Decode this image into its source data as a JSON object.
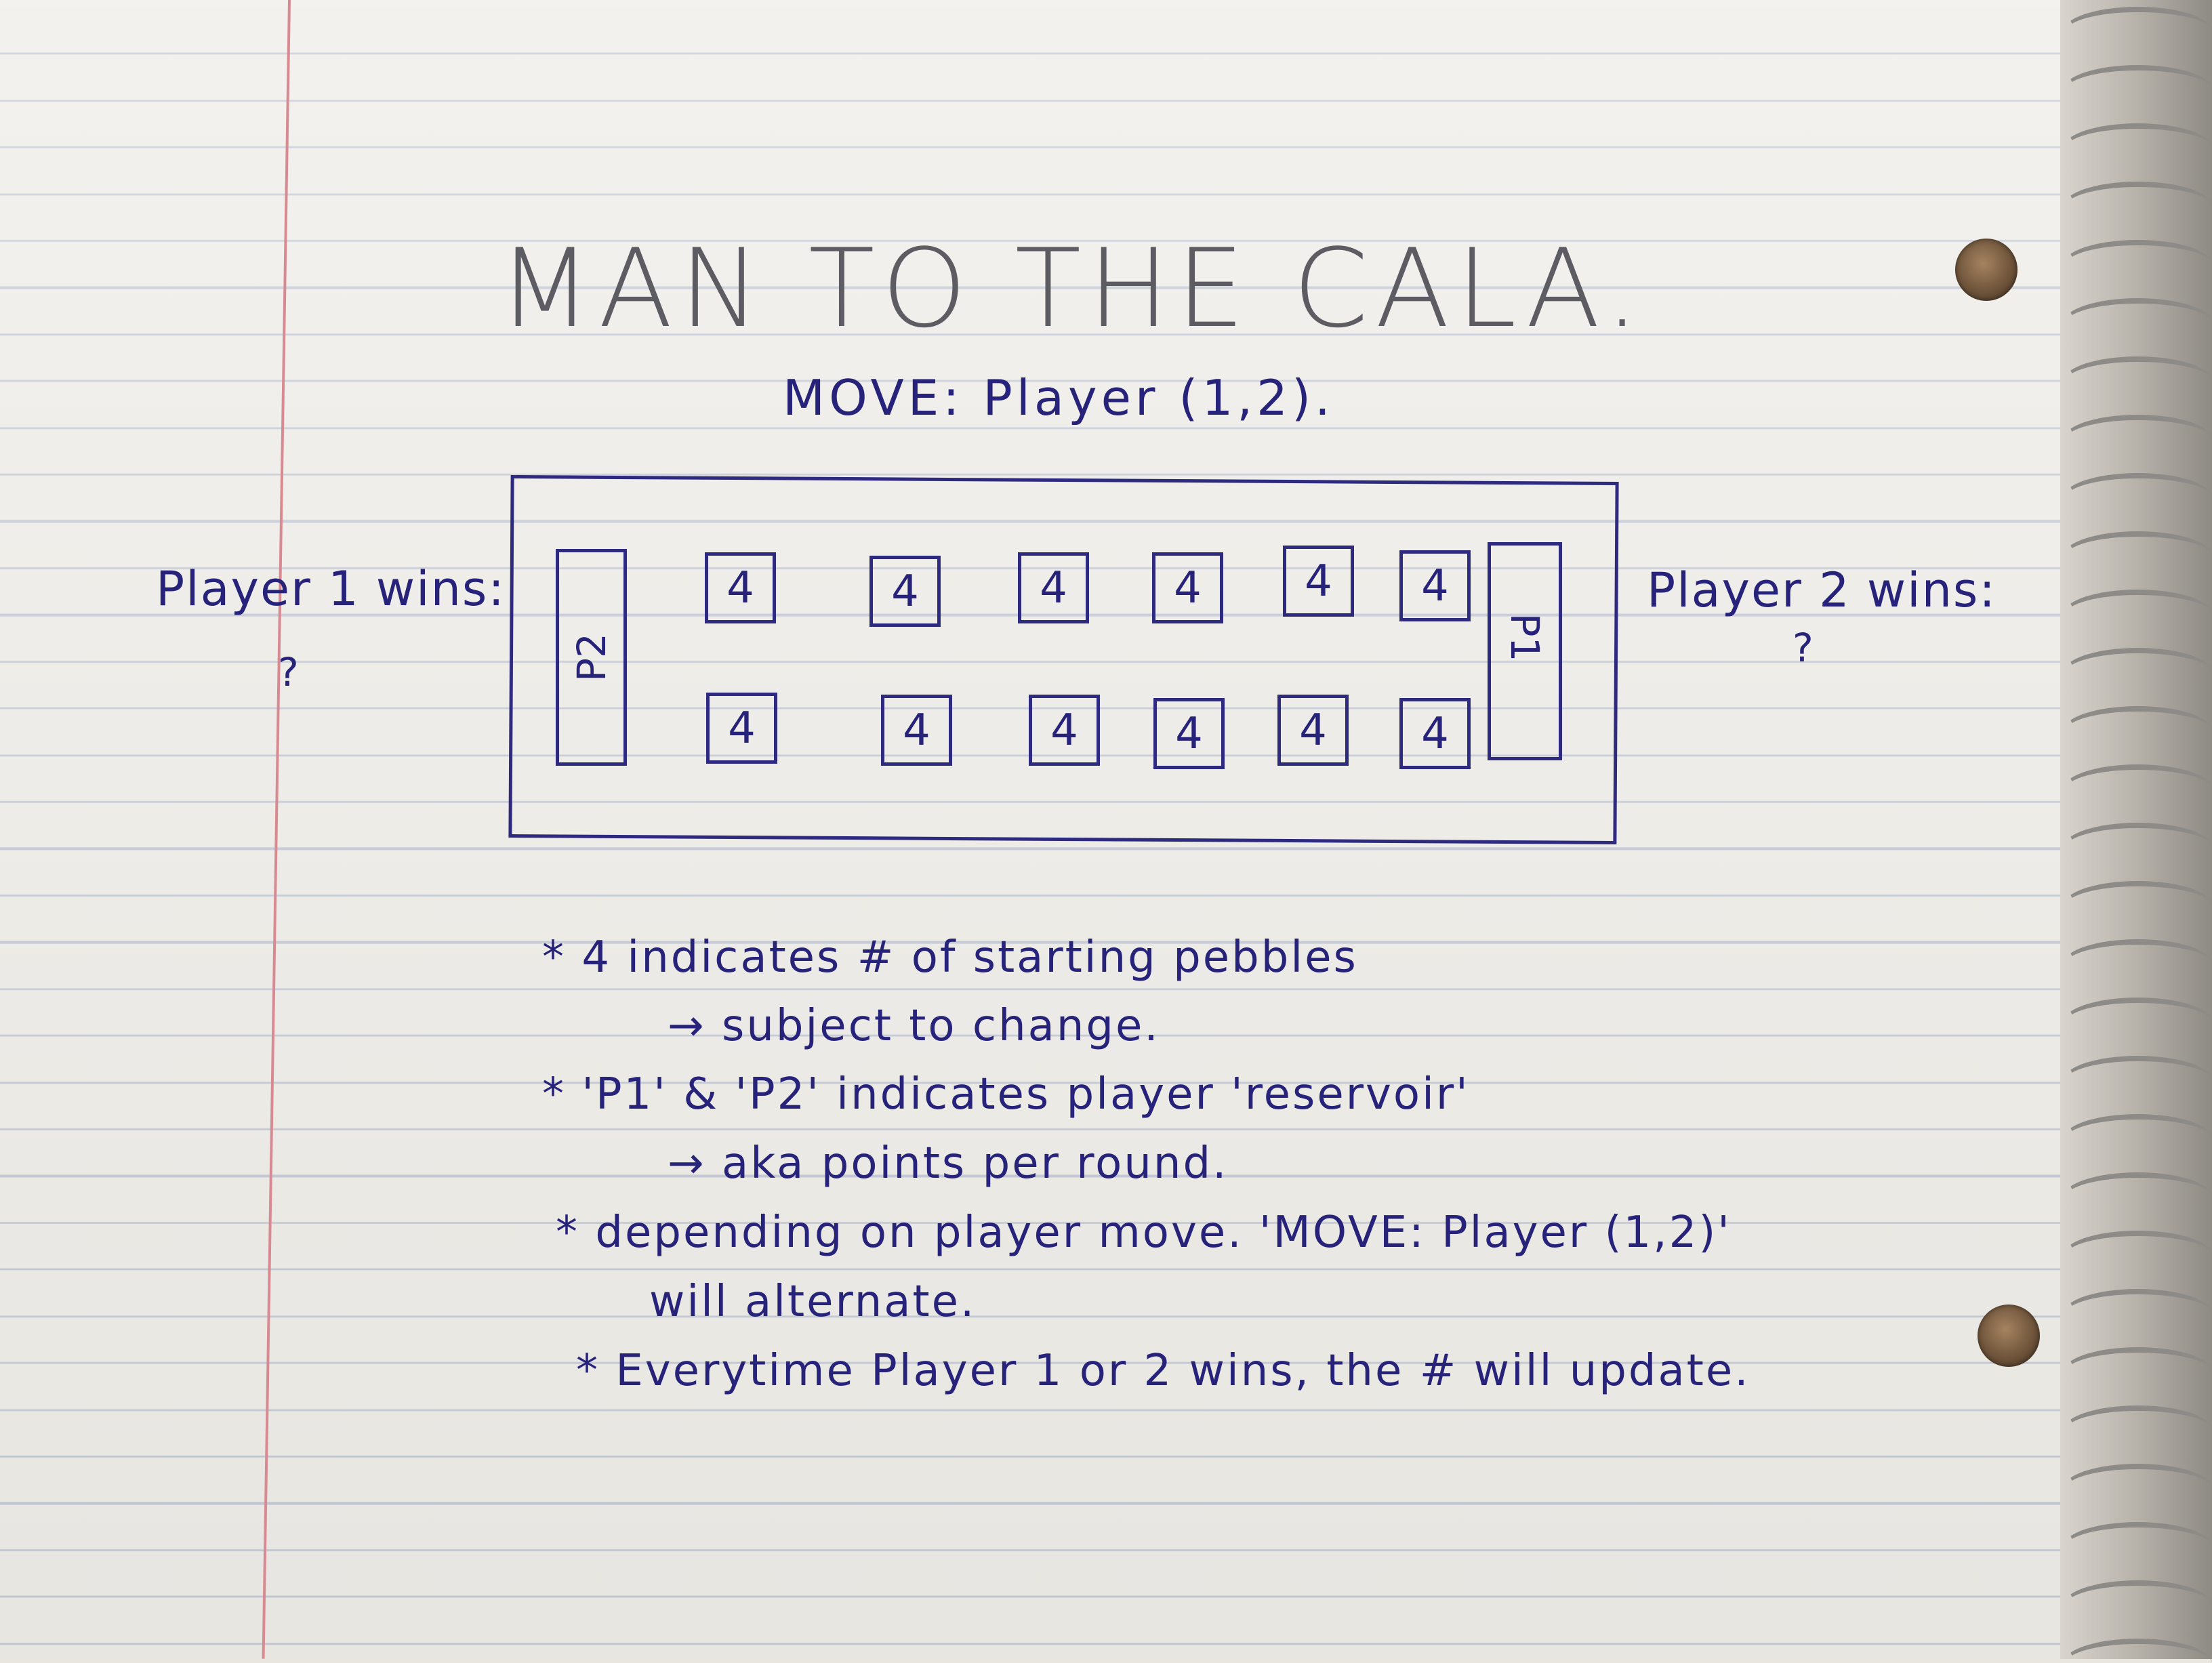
{
  "title": "MAN TO THE CALA.",
  "move_label": "MOVE: Player (1,2).",
  "player1": {
    "wins_label": "Player 1 wins:",
    "wins_value": "?"
  },
  "player2": {
    "wins_label": "Player 2 wins:",
    "wins_value": "?"
  },
  "board": {
    "store_left": "P2",
    "store_right": "P1",
    "top_row": [
      "4",
      "4",
      "4",
      "4",
      "4",
      "4"
    ],
    "bottom_row": [
      "4",
      "4",
      "4",
      "4",
      "4",
      "4"
    ]
  },
  "notes": [
    "* 4 indicates # of starting pebbles",
    "→ subject to change.",
    "* 'P1' & 'P2' indicates player 'reservoir'",
    "→ aka points per round.",
    "* depending on player move. 'MOVE: Player (1,2)'",
    "will alternate.",
    "* Everytime Player 1 or 2 wins, the # will update."
  ],
  "colors": {
    "ink": "#27237a",
    "paper": "#efede8",
    "rule_line": "#c3c9d6",
    "margin_line": "#d88a92",
    "pencil": "#5c5c62"
  }
}
